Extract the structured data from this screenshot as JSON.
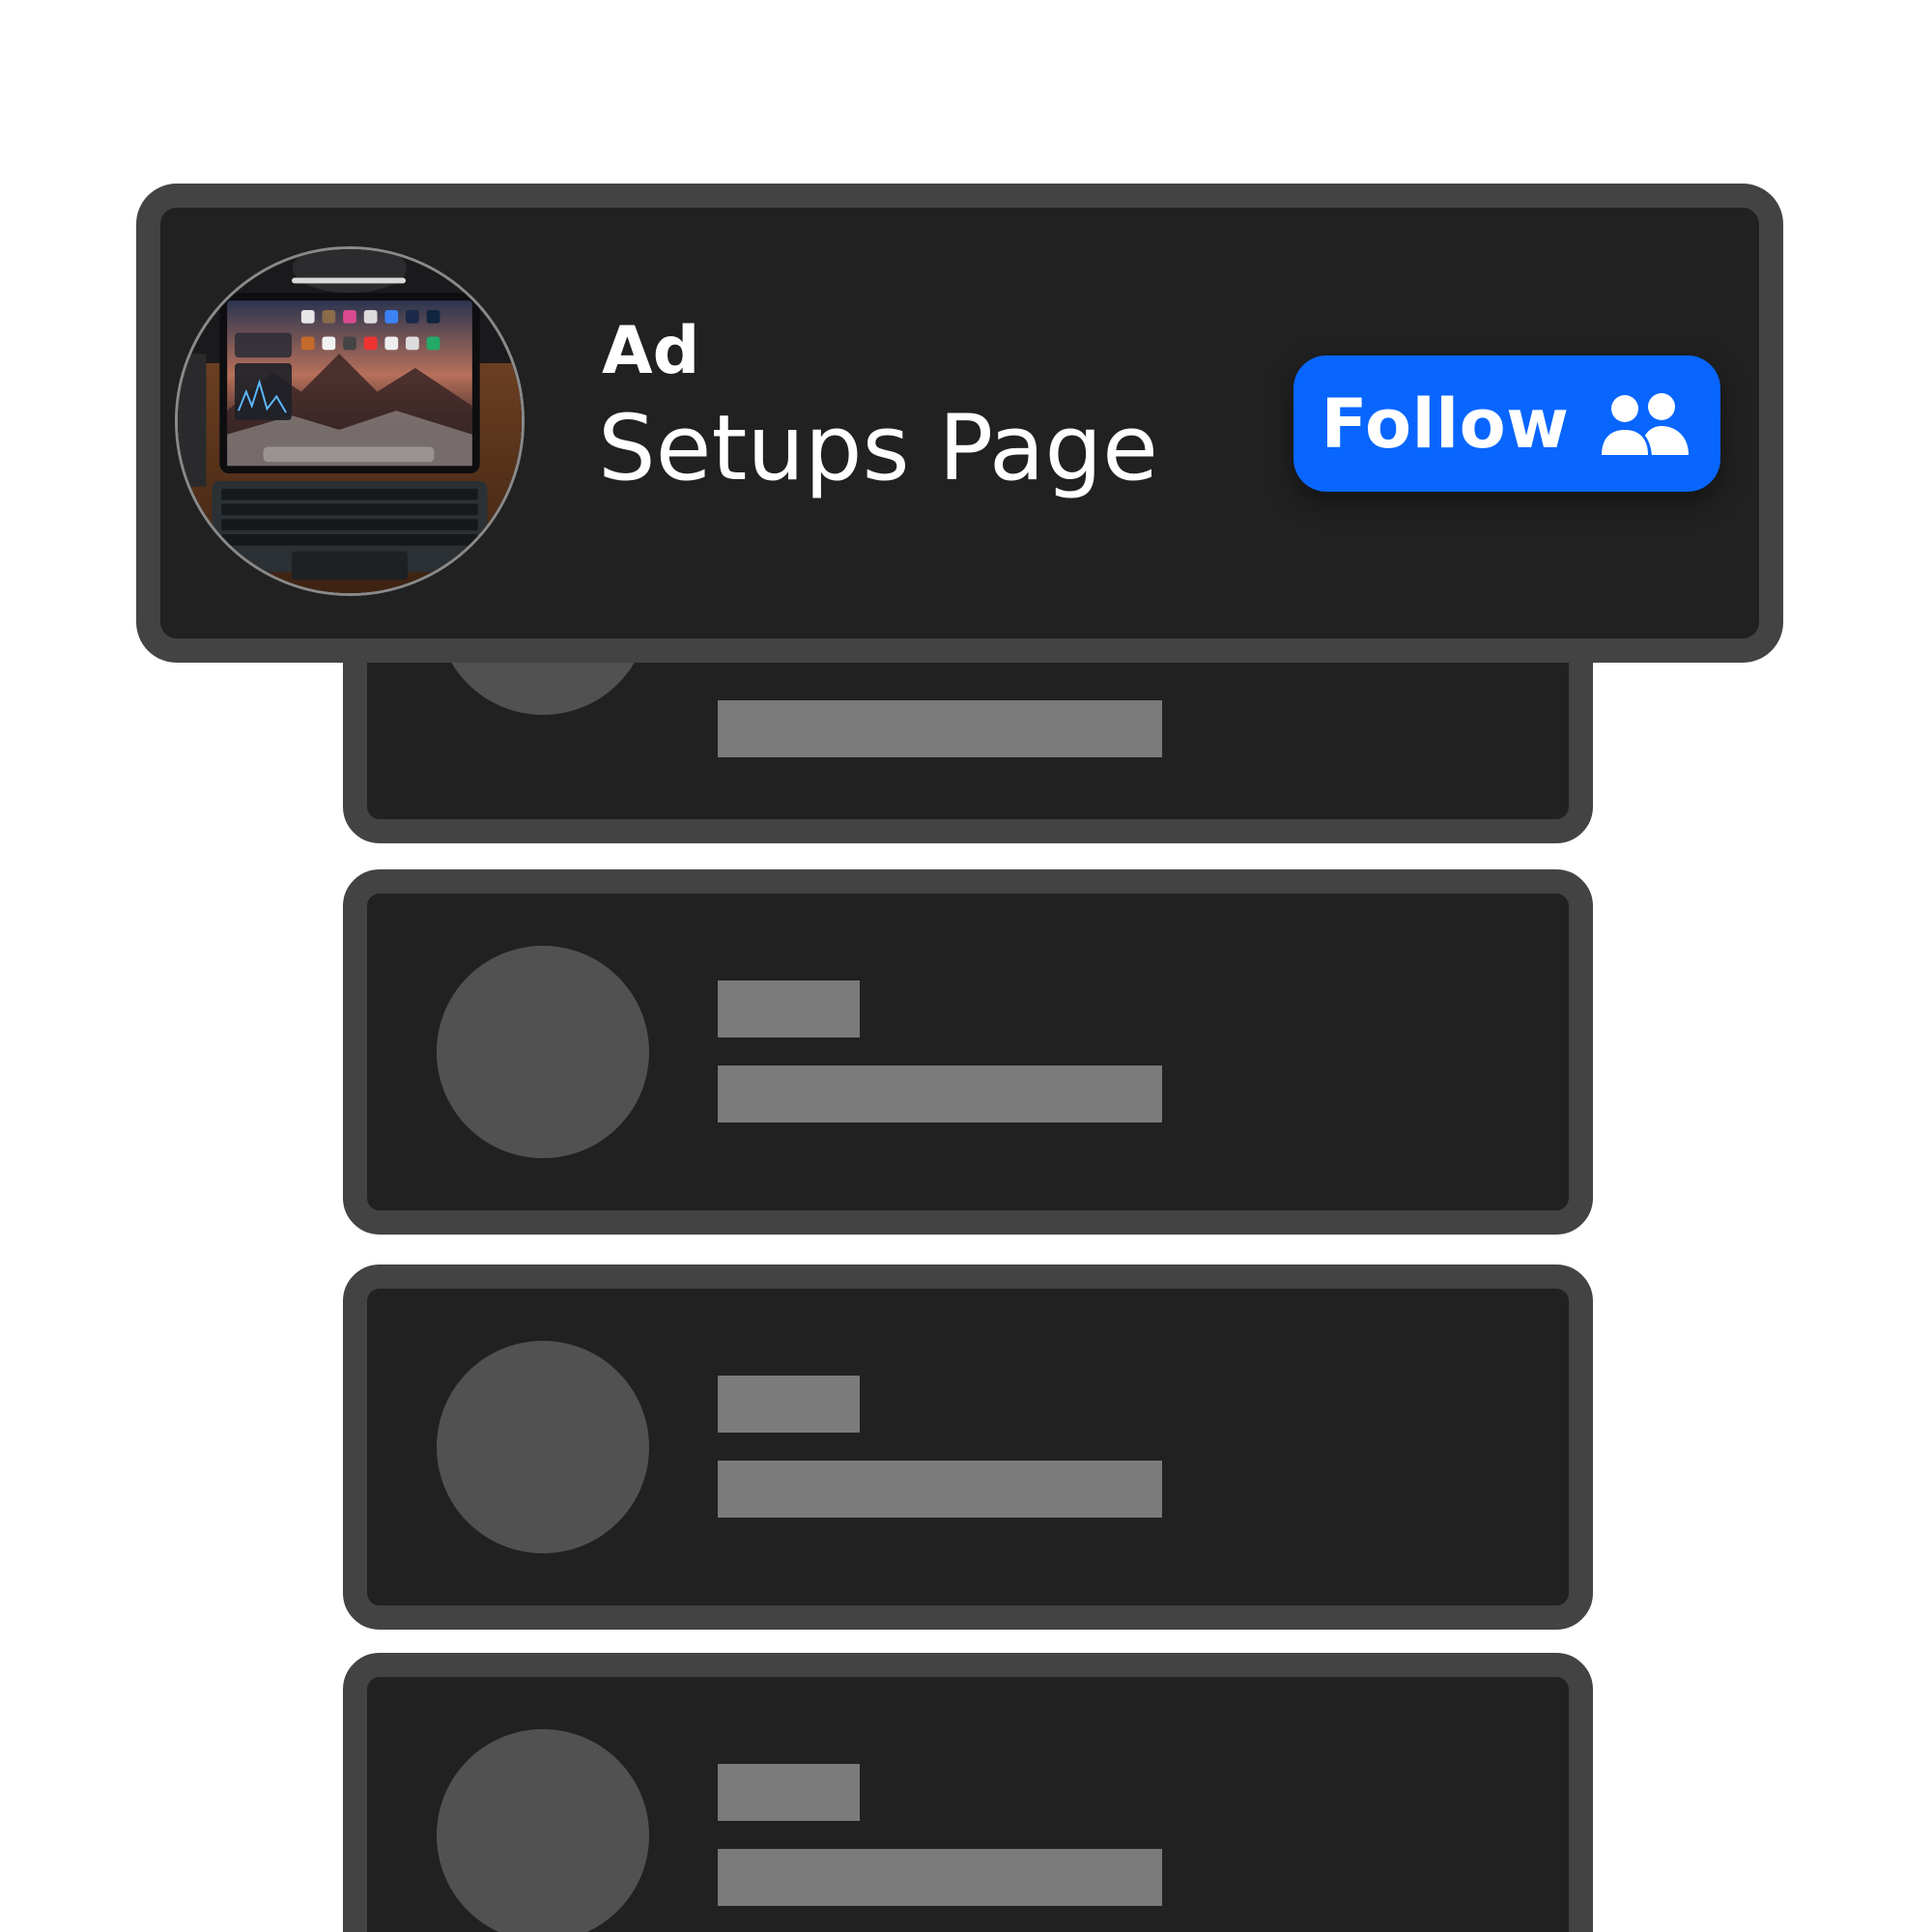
{
  "ad": {
    "label": "Ad",
    "page_name": "Setups Page",
    "follow_label": "Follow",
    "avatar_icon": "tablet-setup-photo",
    "follow_icon": "people-icon",
    "accent_color": "#0866ff"
  },
  "placeholders": {
    "count": 4,
    "card_color": "#212121",
    "border_color": "#434343",
    "avatar_color": "#515151",
    "line_color": "#7b7b7b"
  }
}
